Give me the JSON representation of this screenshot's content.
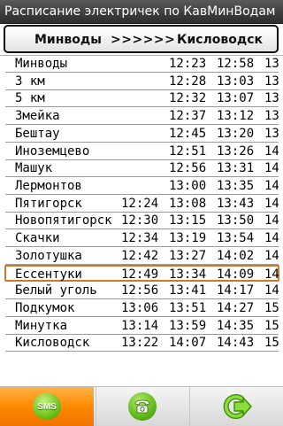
{
  "app": {
    "title": "Расписание электричек по КавМинВодам"
  },
  "route": {
    "from": "Минводы",
    "arrows": ">>>>>>",
    "to": "Кисловодск"
  },
  "schedule": {
    "rows": [
      {
        "station": "Минводы",
        "times": [
          "",
          "12:23",
          "12:58",
          "13:"
        ]
      },
      {
        "station": "3 км",
        "times": [
          "",
          "12:28",
          "13:03",
          "13:"
        ]
      },
      {
        "station": "5 км",
        "times": [
          "",
          "12:32",
          "13:07",
          "13:"
        ]
      },
      {
        "station": "Змейка",
        "times": [
          "",
          "12:37",
          "13:12",
          "13:"
        ]
      },
      {
        "station": "Бештау",
        "times": [
          "",
          "12:45",
          "13:20",
          "13:"
        ]
      },
      {
        "station": "Иноземцево",
        "times": [
          "",
          "12:51",
          "13:26",
          "14:"
        ]
      },
      {
        "station": "Машук",
        "times": [
          "",
          "12:56",
          "13:31",
          "14:"
        ]
      },
      {
        "station": "Лермонтов",
        "times": [
          "",
          "13:00",
          "13:35",
          "14:"
        ]
      },
      {
        "station": "Пятигорск",
        "times": [
          "12:24",
          "13:08",
          "13:43",
          "14:"
        ]
      },
      {
        "station": "Новопятигорск",
        "times": [
          "12:30",
          "13:15",
          "13:50",
          "14:"
        ]
      },
      {
        "station": "Скачки",
        "times": [
          "12:34",
          "13:19",
          "13:54",
          "14:"
        ]
      },
      {
        "station": "Золотушка",
        "times": [
          "12:42",
          "13:27",
          "14:02",
          "14:"
        ]
      },
      {
        "station": "Ессентуки",
        "times": [
          "12:49",
          "13:34",
          "14:09",
          "14:"
        ]
      },
      {
        "station": "Белый уголь",
        "times": [
          "12:56",
          "13:41",
          "14:17",
          "14:"
        ]
      },
      {
        "station": "Подкумок",
        "times": [
          "13:06",
          "13:51",
          "14:27",
          "15:"
        ]
      },
      {
        "station": "Минутка",
        "times": [
          "13:14",
          "13:59",
          "14:35",
          "15:"
        ]
      },
      {
        "station": "Кисловодск",
        "times": [
          "13:22",
          "14:07",
          "14:43",
          "15:"
        ]
      }
    ],
    "selected_station": "Ессентуки"
  },
  "toolbar": {
    "sms_label": "SMS",
    "sms_icon": "sms-icon",
    "call_icon": "phone-icon",
    "exit_icon": "exit-arrow-icon"
  },
  "colors": {
    "selection_border": "#d2782a",
    "toolbar_active": "#ff8a00",
    "icon_green": "#6fc41a"
  }
}
